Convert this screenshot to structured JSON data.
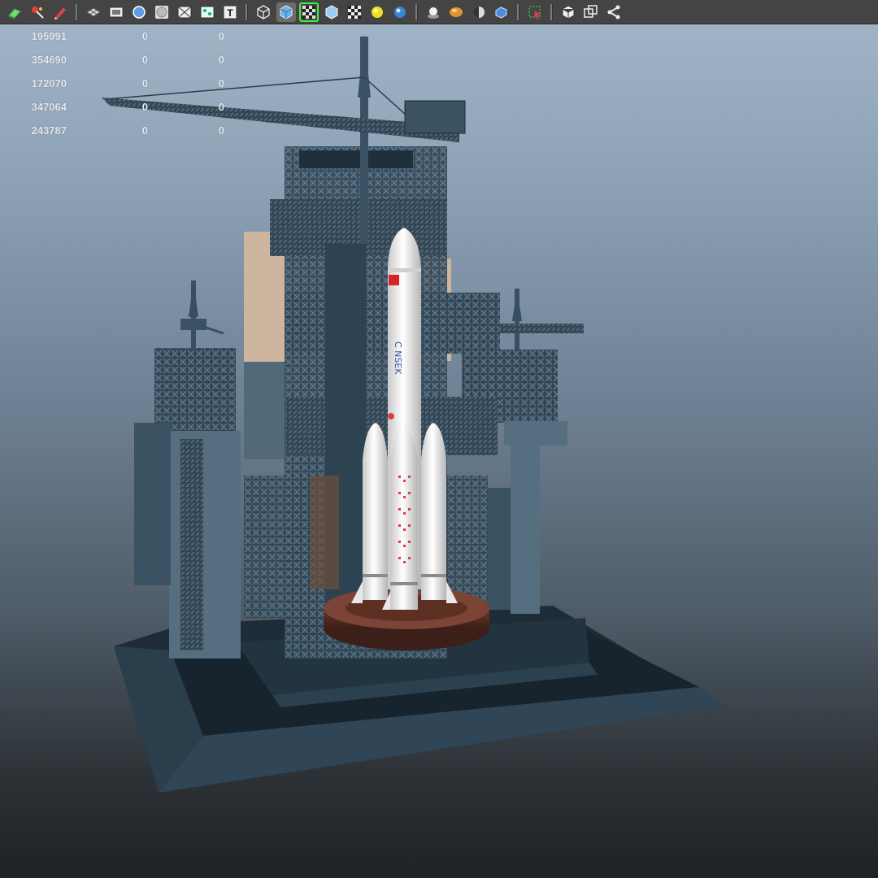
{
  "toolbar": {
    "buttons": [
      {
        "icon": "select-camera-icon",
        "active": false
      },
      {
        "icon": "lock-camera-icon",
        "active": false
      },
      {
        "icon": "bookmark-icon",
        "active": false
      },
      {
        "sep": true
      },
      {
        "icon": "grid-icon",
        "active": false
      },
      {
        "icon": "film-gate-icon",
        "active": false
      },
      {
        "icon": "resolution-gate-icon",
        "active": false
      },
      {
        "icon": "gate-mask-icon",
        "active": false
      },
      {
        "icon": "field-chart-icon",
        "active": false
      },
      {
        "icon": "safe-action-icon",
        "active": false
      },
      {
        "icon": "safe-title-icon",
        "active": false
      },
      {
        "sep": true
      },
      {
        "icon": "wireframe-icon",
        "active": false
      },
      {
        "icon": "smooth-shade-icon",
        "active": true
      },
      {
        "icon": "wireframe-on-shaded-icon",
        "active": false,
        "selected": true
      },
      {
        "icon": "default-material-icon",
        "active": false
      },
      {
        "icon": "textured-icon",
        "active": false
      },
      {
        "icon": "lights-icon",
        "active": false
      },
      {
        "icon": "use-all-lights-icon",
        "active": false
      },
      {
        "sep": true
      },
      {
        "icon": "shadows-icon",
        "active": false
      },
      {
        "icon": "screen-space-ao-icon",
        "active": false
      },
      {
        "icon": "motion-blur-icon",
        "active": false
      },
      {
        "icon": "multisample-aa-icon",
        "active": false
      },
      {
        "sep": true
      },
      {
        "icon": "isolate-select-icon",
        "active": false
      },
      {
        "sep": true
      },
      {
        "icon": "xray-icon",
        "active": false
      },
      {
        "icon": "xray-active-components-icon",
        "active": false
      },
      {
        "icon": "xray-joints-icon",
        "active": false
      }
    ]
  },
  "hud": {
    "rows": [
      [
        "195991",
        "0",
        "0"
      ],
      [
        "354690",
        "0",
        "0"
      ],
      [
        "172070",
        "0",
        "0"
      ],
      [
        "347064",
        "0",
        "0"
      ],
      [
        "243787",
        "0",
        "0"
      ]
    ]
  },
  "viewport": {
    "name": "3d-viewport",
    "scene": "rocket-on-launch-pad"
  },
  "colors": {
    "toolbar_bg": "#444444",
    "structure": "#3e5566",
    "rocket": "#f2f2f2",
    "pad": "#5a3027",
    "flag": "#d62424"
  }
}
